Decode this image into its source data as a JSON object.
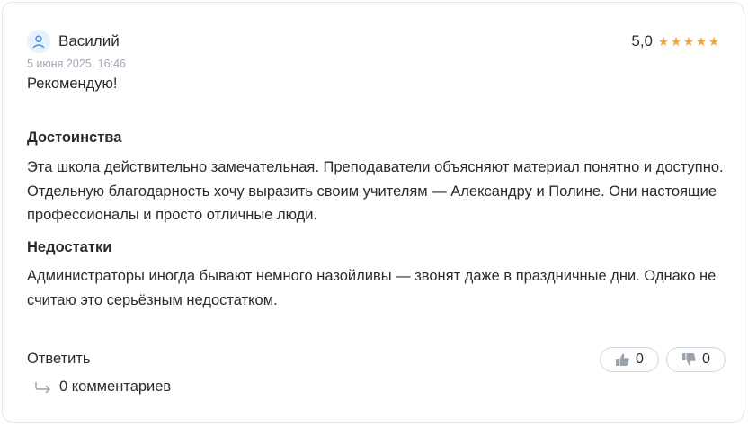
{
  "review": {
    "author": "Василий",
    "rating": "5,0",
    "stars": 5,
    "date": "5 июня 2025, 16:46",
    "summary": "Рекомендую!",
    "pros_heading": "Достоинства",
    "pros_text": "Эта школа действительно замечательная. Преподаватели объясняют материал понятно и доступно. Отдельную благодарность хочу выразить своим учителям — Александру и Полине. Они настоящие профессионалы и просто отличные люди.",
    "cons_heading": "Недостатки",
    "cons_text": "Администраторы иногда бывают немного назойливы — звонят даже в праздничные дни. Однако не считаю это серьёзным недостатком."
  },
  "actions": {
    "reply_label": "Ответить",
    "comments_label": "0 комментариев",
    "likes": "0",
    "dislikes": "0"
  },
  "icons": {
    "avatar": "user-icon",
    "star": "star-icon",
    "comments": "reply-arrow-icon",
    "like": "thumbs-up-icon",
    "dislike": "thumbs-down-icon"
  },
  "colors": {
    "star": "#f2a33a",
    "avatar_bg": "#e9f1fb",
    "avatar_icon": "#4a90e2",
    "muted_text": "#a3a8b3",
    "border": "#e3e5ea"
  }
}
